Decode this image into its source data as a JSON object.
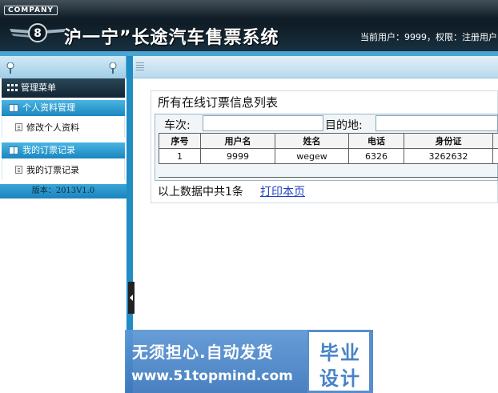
{
  "header": {
    "company_badge": "COMPANY",
    "system_title": "沪一宁”长途汽车售票系统",
    "user_info": "当前用户：9999，权限：注册用户"
  },
  "sidebar": {
    "menu_title": "管理菜单",
    "groups": [
      {
        "label": "个人资料管理",
        "items": [
          {
            "label": "修改个人资料"
          }
        ]
      },
      {
        "label": "我的订票记录",
        "items": [
          {
            "label": "我的订票记录"
          }
        ]
      }
    ],
    "version": "版本：2013V1.0"
  },
  "main": {
    "panel_title": "所有在线订票信息列表",
    "search": {
      "trip_label": "车次:",
      "trip_value": "",
      "destination_label": "目的地:",
      "destination_value": ""
    },
    "table": {
      "columns": [
        "序号",
        "用户名",
        "姓名",
        "电话",
        "身份证"
      ],
      "rows": [
        [
          "1",
          "9999",
          "wegew",
          "6326",
          "3262632"
        ]
      ]
    },
    "summary": "以上数据中共1条",
    "print_link": "打印本页"
  },
  "watermark": {
    "slogan": "无须担心.自动发货",
    "url": "www.51topmind.com",
    "badge_line1": "毕业",
    "badge_line2": "设计"
  },
  "colors": {
    "header_bg": "#0f1c26",
    "accent_blue": "#1f8cc4",
    "group_header": "#1987bf",
    "link": "#2040c0",
    "watermark": "#4f88c9"
  }
}
